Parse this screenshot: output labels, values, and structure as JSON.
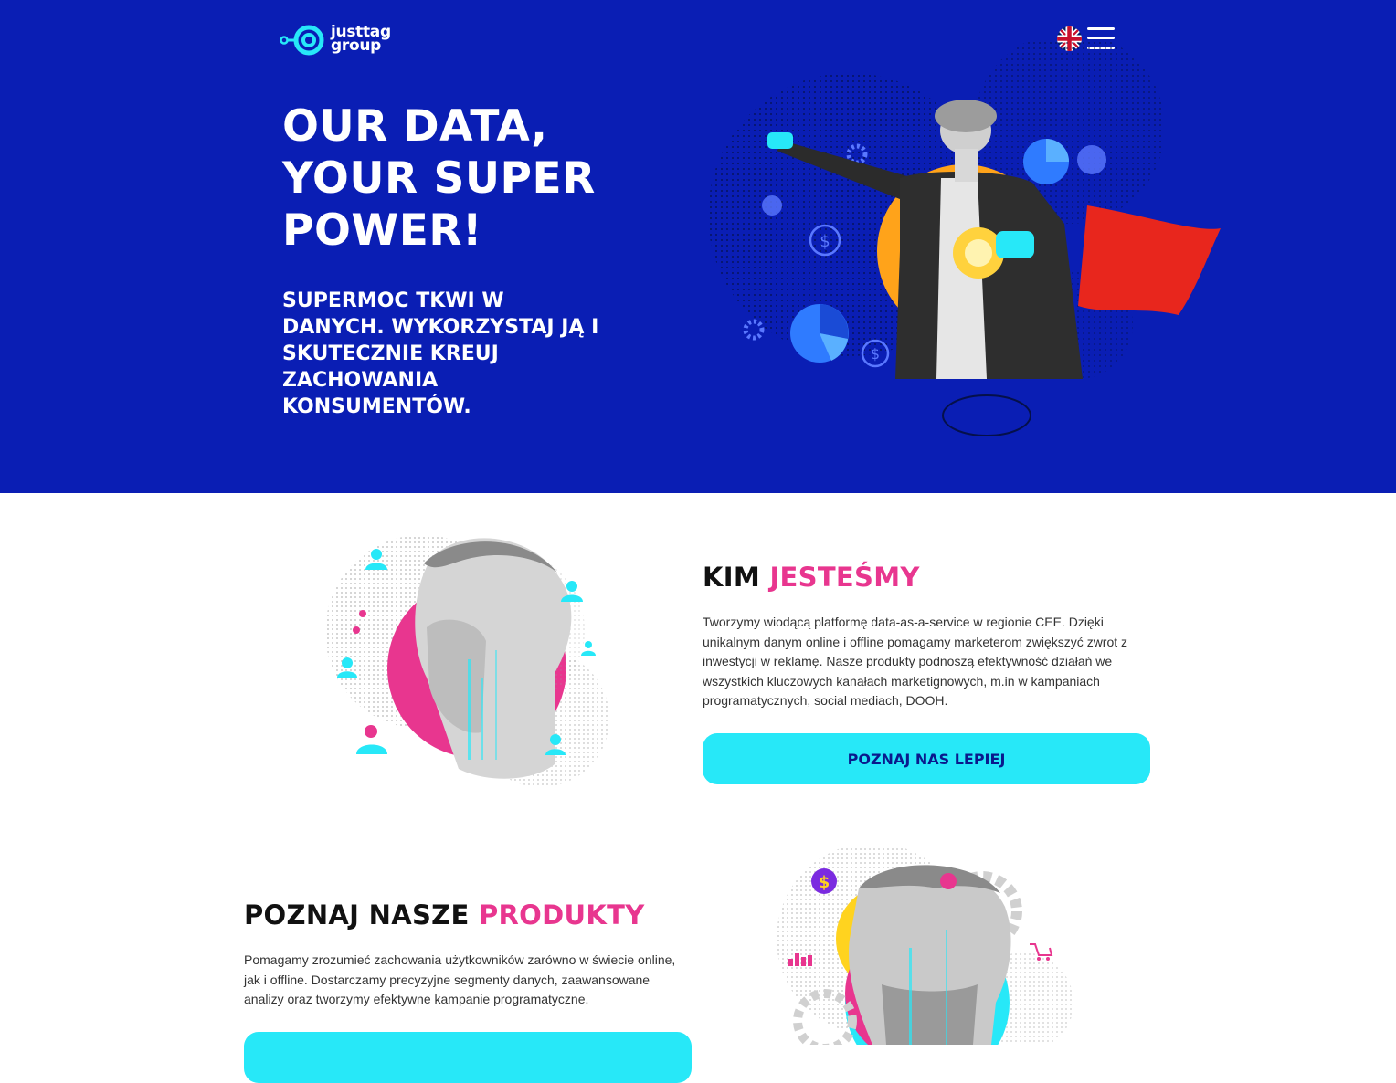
{
  "header": {
    "logo_line1": "justtag",
    "logo_line2": "group",
    "language_flag_icon": "uk-flag-icon",
    "menu_icon": "hamburger-menu-icon"
  },
  "hero": {
    "title": "OUR DATA, YOUR SUPER POWER!",
    "subtitle": "SUPERMOC TKWI W DANYCH. WYKORZYSTAJ JĄ I SKUTECZNIE KREUJ ZACHOWANIA KONSUMENTÓW."
  },
  "about": {
    "heading_plain": "KIM",
    "heading_accent": "JESTEŚMY",
    "text": "Tworzymy wiodącą platformę data-as-a-service w regionie CEE. Dzięki unikalnym danym online i offline pomagamy marketerom zwiększyć zwrot z inwestycji w reklamę. Nasze produkty podnoszą efektywność działań we wszystkich kluczowych kanałach marketignowych, m.in w kampaniach programatycznych, social mediach, DOOH.",
    "button_label": "POZNAJ NAS LEPIEJ"
  },
  "products": {
    "heading_plain": "POZNAJ NASZE",
    "heading_accent": "PRODUKTY",
    "text": "Pomagamy zrozumieć zachowania użytkowników zarówno w świecie online, jak i offline. Dostarczamy precyzyjne segmenty danych, zaawansowane analizy oraz tworzymy efektywne kampanie programatyczne."
  },
  "colors": {
    "hero_bg": "#0a1eb4",
    "accent_pink": "#e8368f",
    "cta_cyan": "#27e8f8",
    "cta_text": "#0a1a8c"
  }
}
